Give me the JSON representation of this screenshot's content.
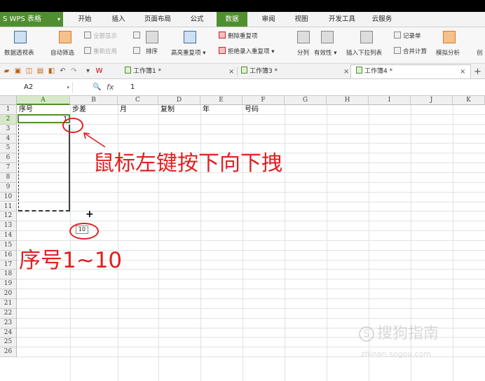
{
  "app": {
    "name": "S WPS 表格",
    "caret": "▾"
  },
  "menu": [
    "开始",
    "插入",
    "页面布局",
    "公式",
    "数据",
    "审阅",
    "视图",
    "开发工具",
    "云服务"
  ],
  "menu_active": "数据",
  "ribbon": {
    "pivot": "数据透视表",
    "autofilter": "自动筛选",
    "show_all": "全部显示",
    "reapply": "重新应用",
    "sort": "排序",
    "highlight_dup": "高亮重复项 ▾",
    "delete_dup": "删除重复项",
    "reject_dup": "拒绝录入重复项 ▾",
    "split": "分列",
    "validity": "有效性 ▾",
    "dropdown": "插入下拉列表",
    "record": "记录单",
    "consolidate": "合并计算",
    "simulate": "模拟分析",
    "create": "创"
  },
  "tabs": [
    {
      "label": "工作簿1 *"
    },
    {
      "label": "工作簿3 *"
    },
    {
      "label": "工作簿4 *"
    }
  ],
  "tab_close": "×",
  "tab_add": "+",
  "formula_bar": {
    "name_box": "A2",
    "fx": "fx",
    "value": "1",
    "zoom_icon": "🔍"
  },
  "columns": [
    "A",
    "B",
    "C",
    "D",
    "E",
    "F",
    "G",
    "H",
    "I",
    "J",
    "K"
  ],
  "rows": [
    "1",
    "2",
    "3",
    "4",
    "5",
    "6",
    "7",
    "8",
    "9",
    "10",
    "11",
    "12",
    "13",
    "14",
    "15",
    "16",
    "17",
    "18",
    "19",
    "20",
    "21",
    "22",
    "23",
    "24",
    "25",
    "26"
  ],
  "headers_row1": {
    "A": "序号",
    "B": "步差",
    "C": "月",
    "D": "复制",
    "E": "年",
    "F": "号码"
  },
  "cell_A2": "1",
  "fill_tooltip": "10",
  "crosshair": "+",
  "annotation_drag": "鼠标左键按下向下拽",
  "annotation_range": "序号1~10",
  "watermark": {
    "brand": "搜狗指南",
    "logo": "S",
    "url": "zhinan.sogou.com"
  },
  "colors": {
    "accent": "#4f8f2f",
    "annotation": "#e02020"
  }
}
